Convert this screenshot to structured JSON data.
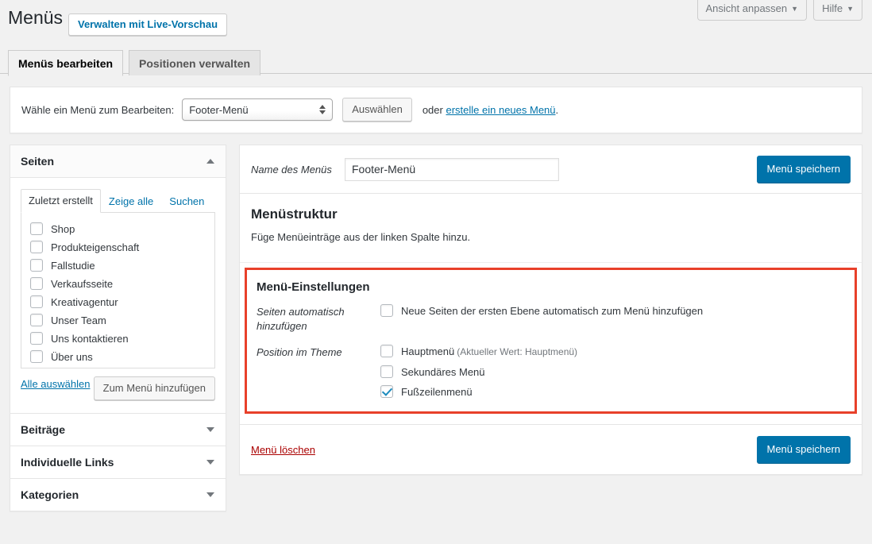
{
  "header": {
    "page_title": "Menüs",
    "live_preview_label": "Verwalten mit Live-Vorschau",
    "screen_options_label": "Ansicht anpassen",
    "help_label": "Hilfe",
    "caret_glyph": "▼"
  },
  "tabs": [
    {
      "label": "Menüs bearbeiten",
      "active": true
    },
    {
      "label": "Positionen verwalten",
      "active": false
    }
  ],
  "select_bar": {
    "label": "Wähle ein Menü zum Bearbeiten:",
    "selected_menu": "Footer-Menü",
    "options": [
      "Footer-Menü"
    ],
    "select_button": "Auswählen",
    "or_text": "oder",
    "create_link": "erstelle ein neues Menü",
    "trailing_period": "."
  },
  "sidebar": {
    "sections": [
      {
        "title": "Seiten",
        "expanded": true,
        "arrow": "up",
        "subtabs": [
          {
            "label": "Zuletzt erstellt",
            "active": true
          },
          {
            "label": "Zeige alle",
            "active": false
          },
          {
            "label": "Suchen",
            "active": false
          }
        ],
        "items": [
          {
            "label": "Shop",
            "checked": false
          },
          {
            "label": "Produkteigenschaft",
            "checked": false
          },
          {
            "label": "Fallstudie",
            "checked": false
          },
          {
            "label": "Verkaufsseite",
            "checked": false
          },
          {
            "label": "Kreativagentur",
            "checked": false
          },
          {
            "label": "Unser Team",
            "checked": false
          },
          {
            "label": "Uns kontaktieren",
            "checked": false
          },
          {
            "label": "Über uns",
            "checked": false
          }
        ],
        "select_all_label": "Alle auswählen",
        "add_button_label": "Zum Menü hinzufügen"
      },
      {
        "title": "Beiträge",
        "expanded": false,
        "arrow": "down"
      },
      {
        "title": "Individuelle Links",
        "expanded": false,
        "arrow": "down"
      },
      {
        "title": "Kategorien",
        "expanded": false,
        "arrow": "down"
      }
    ]
  },
  "editor": {
    "menu_name_label": "Name des Menüs",
    "menu_name_value": "Footer-Menü",
    "menu_name_placeholder": "Name des Menüs",
    "save_label": "Menü speichern",
    "structure_title": "Menüstruktur",
    "structure_description": "Füge Menüeinträge aus der linken Spalte hinzu.",
    "settings": {
      "title": "Menü-Einstellungen",
      "highlight_color": "#e8402a",
      "rows": [
        {
          "label": "Seiten automatisch hinzufügen",
          "options": [
            {
              "label": "Neue Seiten der ersten Ebene automatisch zum Menü hinzufügen",
              "checked": false,
              "note": ""
            }
          ]
        },
        {
          "label": "Position im Theme",
          "options": [
            {
              "label": "Hauptmenü",
              "checked": false,
              "note": "(Aktueller Wert: Hauptmenü)"
            },
            {
              "label": "Sekundäres Menü",
              "checked": false,
              "note": ""
            },
            {
              "label": "Fußzeilenmenü",
              "checked": true,
              "note": ""
            }
          ]
        }
      ]
    },
    "delete_label": "Menü löschen",
    "save_label_bottom": "Menü speichern"
  }
}
